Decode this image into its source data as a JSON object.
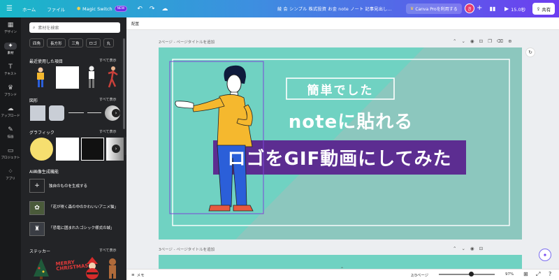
{
  "topbar": {
    "menu_icon": "☰",
    "home": "ホーム",
    "file": "ファイル",
    "magic_switch": "Magic Switch",
    "magic_badge": "NEW",
    "doc_title": "綾 会 シンプル 株式投資 お金 note ノート 記事見出し...",
    "pro_button": "Canva Proを利用する",
    "avatar_text": "き",
    "play_label": "15.0秒",
    "share_label": "共有"
  },
  "leftrail": {
    "items": [
      {
        "label": "デザイン",
        "icon": "▦"
      },
      {
        "label": "素材",
        "icon": "✦"
      },
      {
        "label": "テキスト",
        "icon": "T"
      },
      {
        "label": "ブランド",
        "icon": "♛"
      },
      {
        "label": "アップロード",
        "icon": "☁"
      },
      {
        "label": "描画",
        "icon": "✎"
      },
      {
        "label": "プロジェクト",
        "icon": "▭"
      },
      {
        "label": "アプリ",
        "icon": "⁘"
      }
    ]
  },
  "panel": {
    "search_placeholder": "素材を検索",
    "chips": [
      "四角",
      "長方形",
      "三角",
      "ロゴ",
      "丸"
    ],
    "recent_title": "最近使用した項目",
    "see_all": "すべて表示",
    "shapes_title": "図形",
    "graphics_title": "グラフィック",
    "ai_title": "AI画像生成機能",
    "ai_items": [
      {
        "label": "独自のものを生成する",
        "icon": "+"
      },
      {
        "label": "「花が咲く森の中のかわいいアニメ猫」",
        "icon": "✿"
      },
      {
        "label": "「恐竜に囲まれたゴシック様式の城」",
        "icon": "♜"
      }
    ],
    "stickers_title": "ステッカー"
  },
  "editor": {
    "toolbar_label": "配置",
    "page2_label": "2ページ - ページタイトルを追加",
    "page3_label": "3ページ - ページタイトルを追加"
  },
  "slide": {
    "box_title": "簡単でした",
    "subtitle": "noteに貼れる",
    "banner": "ロゴをGIF動画にしてみた",
    "bg_color": "#70d2c2",
    "banner_color": "#5c2d91",
    "text_color": "#ffffff"
  },
  "bottombar": {
    "memo": "メモ",
    "page_count": "2/3ページ",
    "zoom": "97%",
    "zoom_level": 0.58
  }
}
